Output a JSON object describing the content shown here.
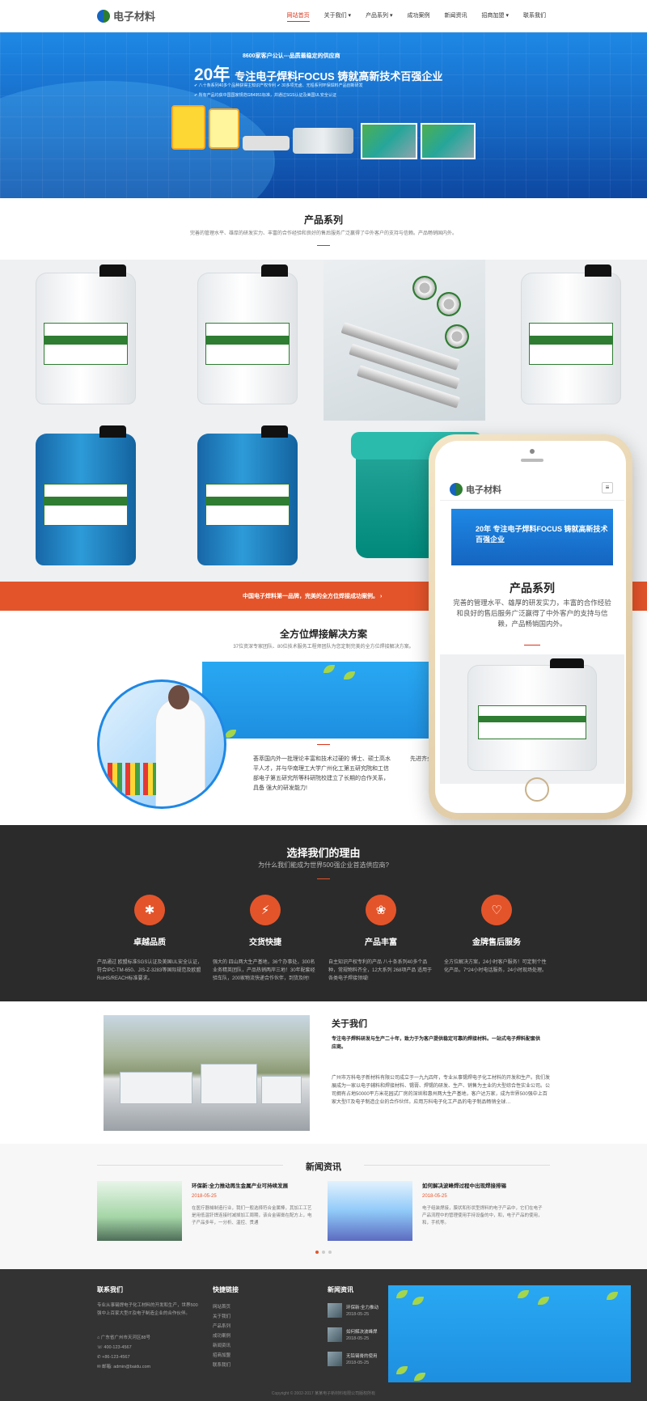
{
  "header": {
    "logo_text": "电子材料",
    "nav": [
      "网站首页",
      "关于我们 ▾",
      "产品系列 ▾",
      "成功案例",
      "新闻资讯",
      "招商加盟 ▾",
      "联系我们"
    ]
  },
  "banner": {
    "subtitle": "8600家客户公认---品质最稳定的供应商",
    "title_big": "20年",
    "title_rest": "专注电子焊料FOCUS 铸就高新技术百强企业",
    "line1": "✔ 八十条系列40多个品种获得主知识产权专利   ✔ 30多项无卤、无铅系列环保焊料产品创新研发",
    "line2": "✔ 所有产品均获中国国家规范GB4951标准，并通过SGS认证及美国UL安全认证"
  },
  "products": {
    "title": "产品系列",
    "desc": "完善的管理水平、雄厚的研发实力、丰富的合作经验和良好的售后服务广泛赢得了中外客户的支持与信赖。产品畅销国内外。",
    "cta": "中国电子焊料第一品牌，完美的全方位焊接成功案例。 ›"
  },
  "solutions": {
    "title": "全方位焊接解决方案",
    "desc": "37位资深专家团队、80位技术服务工程师团队为您定制完美的全方位焊接解决方案。",
    "text": "荟萃国内外一批理论丰富和技术过硬的 博士、硕士高水平人才，并与华南理工大学广州化工第五研究院和工信部电子第五研究所等科研院校建立了长期的合作关系，具备 强大的研发能力!",
    "text2": "先进齐全的检测服务工序实施检测户提供"
  },
  "phone": {
    "logo_text": "电子材料",
    "banner_text": "20年 专注电子焊料FOCUS 铸就高新技术百强企业",
    "title": "产品系列",
    "desc": "完善的管理水平、雄厚的研发实力，丰富的合作经验和良好的售后服务广泛赢得了中外客户的支持与信赖，产品畅销国内外。"
  },
  "why": {
    "title": "选择我们的理由",
    "subtitle": "为什么我们能成为世界500强企业首选供应商?",
    "items": [
      {
        "icon": "✱",
        "name": "卓越品质",
        "desc": "产品通过 欧盟标准SGS认证及美国UL安全认证，符合IPC-TM-650、JIS-Z-3283等国际规范及欧盟RoHS/REACH标准要求。"
      },
      {
        "icon": "⚡",
        "name": "交货快捷",
        "desc": "强大的 四山两大生产基地，36个办事处，300名业务精英团队，产品热销两岸三地！30年配套经验车队，200家物流快递合作伙伴，到货及时!"
      },
      {
        "icon": "❀",
        "name": "产品丰富",
        "desc": "自主知识产权专利的产品 八十条系列40多个品种，常规物料齐全，12大系列 268项产品 适用于各类电子焊接领域!"
      },
      {
        "icon": "♡",
        "name": "金牌售后服务",
        "desc": "全方位解决方案，24小时客户服务！可定制个性化产品，7*24小时电话服务，24小时现场处理。"
      }
    ]
  },
  "about": {
    "title": "关于我们",
    "lead": "专注电子焊料研发与生产二十年，致力于为客户提供稳定可靠的焊接材料。一站式电子焊料配套供应商。",
    "body": "广州市万科电子新材料有限公司成立于一九九四年，专业从事锡焊电子化工材料的开发和生产。我们发展成为一家以电子辅料和焊接材料、锡膏、焊锡的研发、生产、销售为主业的大型综合性实业公司。公司拥有占地50000平方米花园式厂房的深圳和惠州两大生产基地，客户达万家，成为世界500强中上百家大型IT及电子制造企业的合作伙伴。应用万科电子化工产品的电子制品畅销全球…"
  },
  "news": {
    "title": "新闻资讯",
    "items": [
      {
        "headline": "环保新:全力推动再生金属产业可持续发展",
        "date": "2018-05-25",
        "summary": "在医疗器械制造行业，我们一般选择符合金属棒，其加工工艺是用低温钎焊连接时减掉加工周期，该合金锡膏在配方上，电子产品多年，一分析、温控、贯通"
      },
      {
        "headline": "如何解决波峰焊过程中出现焊接排锡",
        "date": "2018-05-25",
        "summary": "电子组装焊接，膜状和形状型焊料的电子产品中，它们在电子产品流程中的管理使用手持设备的中，和，电子产品的使用，和，手机等。"
      }
    ]
  },
  "footer": {
    "contact_title": "联系我们",
    "contact_intro": "专业从事锡焊电子化工材料的开发和生产，世界500强中上百家大型IT及电子制造企业的合作伙伴。",
    "address": "⌂ 广东省广州市天河区88号",
    "phone": "☏ 400-123-4567",
    "mobile": "✆ +86-123-4567",
    "email": "✉ 邮箱: admin@baidu.com",
    "links_title": "快捷链接",
    "links": [
      "网站首页",
      "关于我们",
      "产品系列",
      "成功案例",
      "新闻资讯",
      "招商加盟",
      "联系我们"
    ],
    "news_title": "新闻资讯",
    "news": [
      {
        "title": "环保新:全力推动",
        "date": "2018-05-25"
      },
      {
        "title": "如何解决波峰焊",
        "date": "2018-05-25"
      },
      {
        "title": "无铅锡膏的使用",
        "date": "2018-05-25"
      }
    ],
    "copyright": "Copyright © 2002-2017 某某电子新材料有限公司版权所有"
  },
  "colors": {
    "accent": "#e4542a",
    "banner_blue": "#1565c0",
    "dark_section": "#2b2b2b"
  }
}
